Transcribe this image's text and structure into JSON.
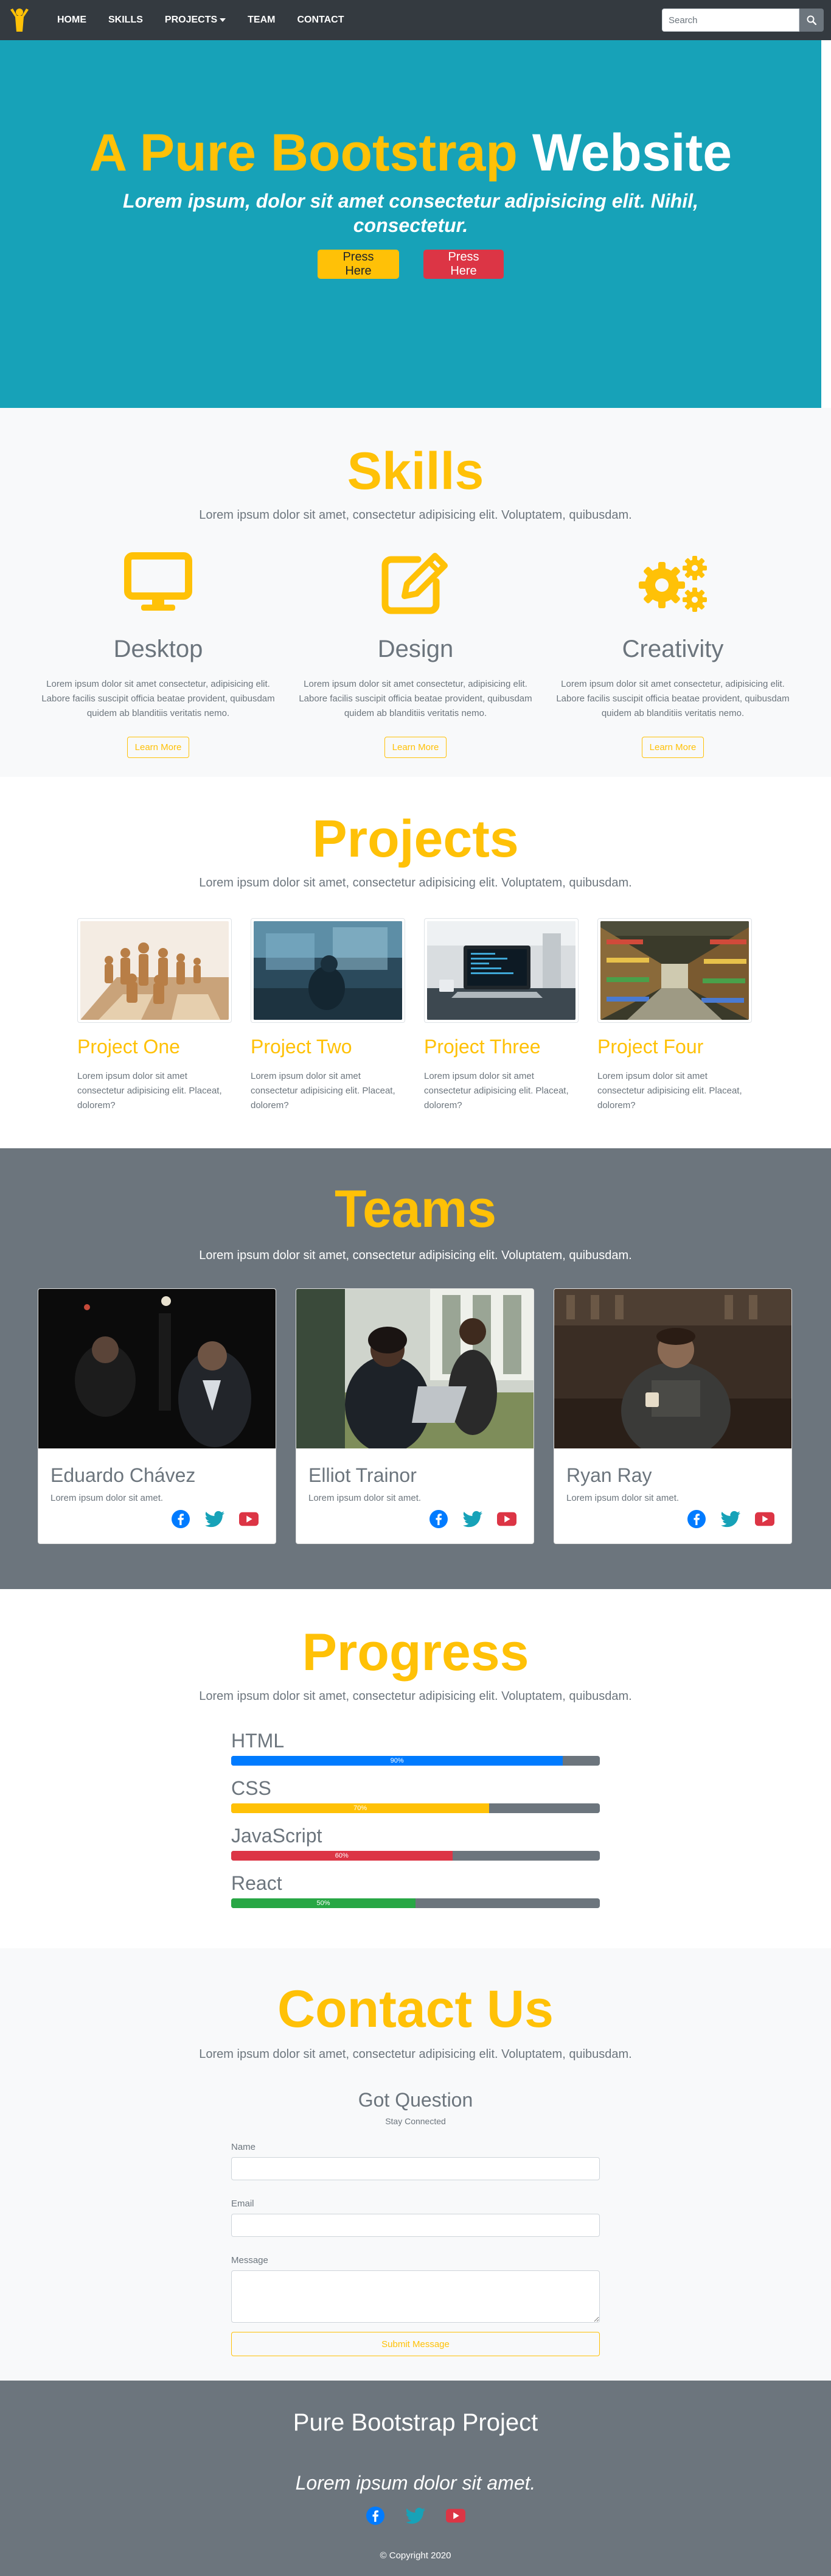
{
  "navbar": {
    "brand_icon": "person-arms-up-icon",
    "links": [
      "HOME",
      "SKILLS",
      "PROJECTS",
      "TEAM",
      "CONTACT"
    ],
    "search_placeholder": "Search",
    "search_icon": "search-icon"
  },
  "hero": {
    "title_part1": "A Pure Bootstrap",
    "title_part2": "Website",
    "subtitle": "Lorem ipsum, dolor sit amet consectetur adipisicing elit. Nihil, consectetur.",
    "button1": "Press Here",
    "button2": "Press Here"
  },
  "skills": {
    "title": "Skills",
    "lead": "Lorem ipsum dolor sit amet, consectetur adipisicing elit. Voluptatem, quibusdam.",
    "items": [
      {
        "icon": "desktop-icon",
        "name": "Desktop",
        "text": "Lorem ipsum dolor sit amet consectetur, adipisicing elit. Labore facilis suscipit officia beatae provident, quibusdam quidem ab blanditiis veritatis nemo.",
        "button": "Learn More"
      },
      {
        "icon": "edit-icon",
        "name": "Design",
        "text": "Lorem ipsum dolor sit amet consectetur, adipisicing elit. Labore facilis suscipit officia beatae provident, quibusdam quidem ab blanditiis veritatis nemo.",
        "button": "Learn More"
      },
      {
        "icon": "cogs-icon",
        "name": "Creativity",
        "text": "Lorem ipsum dolor sit amet consectetur, adipisicing elit. Labore facilis suscipit officia beatae provident, quibusdam quidem ab blanditiis veritatis nemo.",
        "button": "Learn More"
      }
    ]
  },
  "projects": {
    "title": "Projects",
    "lead": "Lorem ipsum dolor sit amet, consectetur adipisicing elit. Voluptatem, quibusdam.",
    "items": [
      {
        "name": "Project One",
        "text": "Lorem ipsum dolor sit amet consectetur adipisicing elit. Placeat, dolorem?"
      },
      {
        "name": "Project Two",
        "text": "Lorem ipsum dolor sit amet consectetur adipisicing elit. Placeat, dolorem?"
      },
      {
        "name": "Project Three",
        "text": "Lorem ipsum dolor sit amet consectetur adipisicing elit. Placeat, dolorem?"
      },
      {
        "name": "Project Four",
        "text": "Lorem ipsum dolor sit amet consectetur adipisicing elit. Placeat, dolorem?"
      }
    ]
  },
  "teams": {
    "title": "Teams",
    "lead": "Lorem ipsum dolor sit amet, consectetur adipisicing elit. Voluptatem, quibusdam.",
    "members": [
      {
        "name": "Eduardo Chávez",
        "text": "Lorem ipsum dolor sit amet."
      },
      {
        "name": "Elliot Trainor",
        "text": "Lorem ipsum dolor sit amet."
      },
      {
        "name": "Ryan Ray",
        "text": "Lorem ipsum dolor sit amet."
      }
    ],
    "social_icons": [
      "facebook-icon",
      "twitter-icon",
      "youtube-icon"
    ]
  },
  "progress": {
    "title": "Progress",
    "lead": "Lorem ipsum dolor sit amet, consectetur adipisicing elit. Voluptatem, quibusdam.",
    "bars": [
      {
        "label": "HTML",
        "percent": 90,
        "text": "90%",
        "color": "#007bff"
      },
      {
        "label": "CSS",
        "percent": 70,
        "text": "70%",
        "color": "#ffc107"
      },
      {
        "label": "JavaScript",
        "percent": 60,
        "text": "60%",
        "color": "#dc3545"
      },
      {
        "label": "React",
        "percent": 50,
        "text": "50%",
        "color": "#28a745"
      }
    ]
  },
  "contact": {
    "title": "Contact Us",
    "lead": "Lorem ipsum dolor sit amet, consectetur adipisicing elit. Voluptatem, quibusdam.",
    "form_title": "Got Question",
    "form_subtitle": "Stay Connected",
    "name_label": "Name",
    "email_label": "Email",
    "message_label": "Message",
    "submit": "Submit Message"
  },
  "footer": {
    "title": "Pure Bootstrap Project",
    "subtitle": "Lorem ipsum dolor sit amet.",
    "copyright": "© Copyright 2020"
  },
  "colors": {
    "accent": "#ffc107",
    "hero_bg": "#17a2b8",
    "dark": "#343a40",
    "grey": "#6c757d"
  }
}
